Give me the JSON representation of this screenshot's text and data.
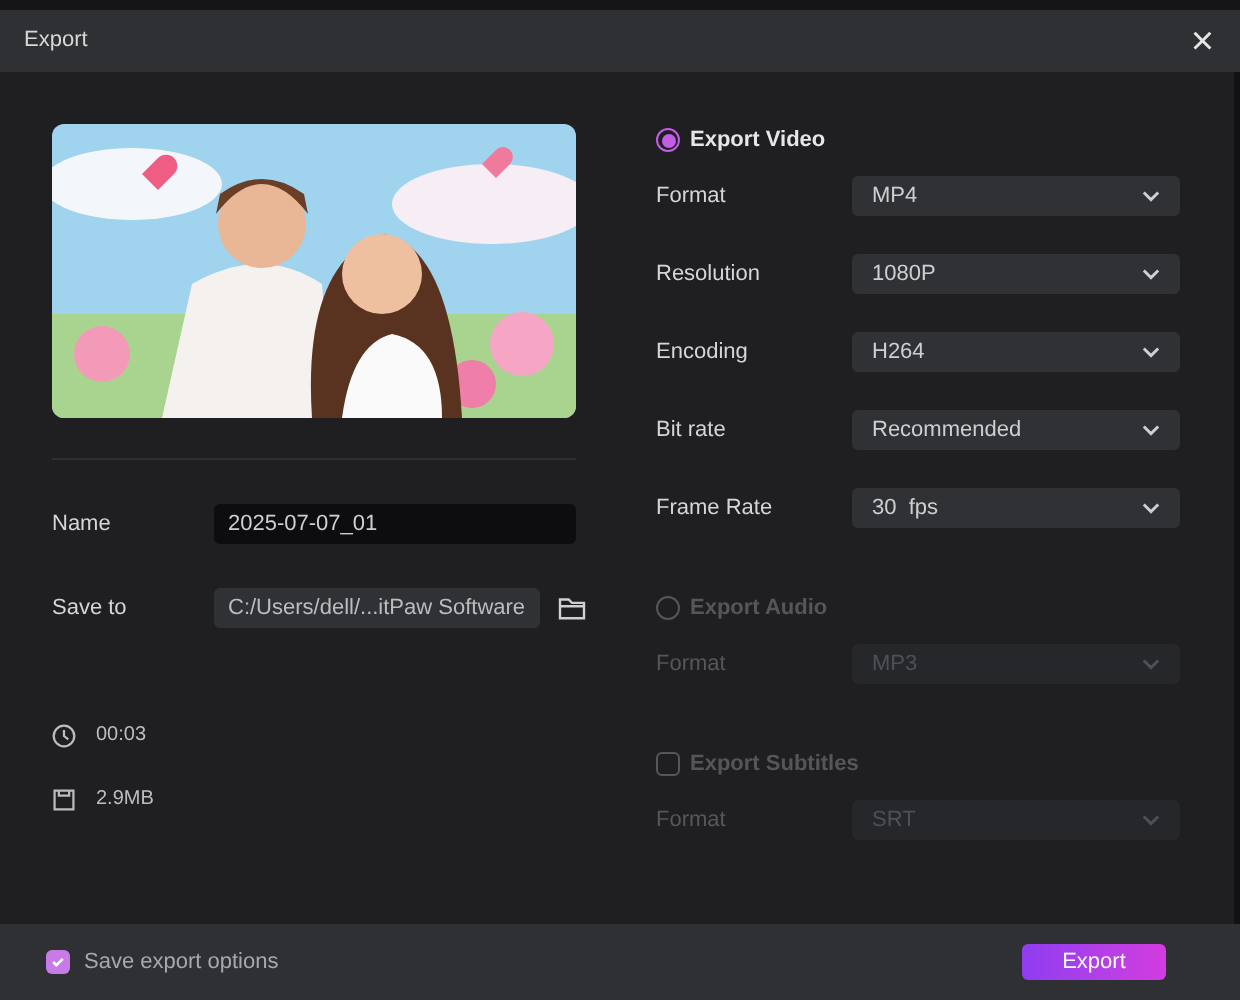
{
  "window": {
    "title": "Export",
    "close": "×"
  },
  "fields": [
    {
      "label": "Name",
      "value": "2025-07-07_01",
      "kind": "text"
    },
    {
      "label": "Save to",
      "value": "C:/Users/dell/...itPaw Software",
      "kind": "path"
    }
  ],
  "info": [
    {
      "kind": "duration",
      "text": "00:03"
    },
    {
      "kind": "size",
      "text": "2.9MB"
    }
  ],
  "sections": [
    {
      "kind": "radio",
      "label": "Export Video",
      "selected": true,
      "disabled": false,
      "rows": [
        {
          "label": "Format",
          "value": "MP4"
        },
        {
          "label": "Resolution",
          "value": "1080P"
        },
        {
          "label": "Encoding",
          "value": "H264"
        },
        {
          "label": "Bit rate",
          "value": "Recommended"
        },
        {
          "label": "Frame Rate",
          "value": "30  fps"
        }
      ]
    },
    {
      "kind": "radio",
      "label": "Export Audio",
      "selected": false,
      "disabled": true,
      "rows": [
        {
          "label": "Format",
          "value": "MP3"
        }
      ]
    },
    {
      "kind": "checkbox",
      "label": "Export Subtitles",
      "checked": false,
      "disabled": true,
      "rows": [
        {
          "label": "Format",
          "value": "SRT"
        }
      ]
    }
  ],
  "footer": {
    "save_options": {
      "label": "Save export options",
      "checked": true
    },
    "export_button": "Export"
  }
}
